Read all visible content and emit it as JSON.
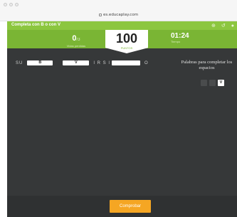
{
  "browser": {
    "url": "es.educaplay.com"
  },
  "header": {
    "title": "Completa con B o con V",
    "icons": [
      "globe-icon",
      "refresh-icon",
      "help-icon"
    ]
  },
  "score": {
    "lives_value": "0",
    "lives_total": "/3",
    "lives_label": "Vidas perdidas",
    "points_value": "100",
    "points_label": "PUNTOS",
    "timer_value": "01:24",
    "timer_label": "Tiempo"
  },
  "sentence": {
    "prefix": "SU",
    "blank1_value": "B",
    "blank2_value": "V",
    "middle": "I R S I",
    "blank3_value": "",
    "suffix": "O"
  },
  "panel": {
    "title": "Palabras para completar los espacios",
    "tile_letter": "V"
  },
  "footer": {
    "check_label": "Comprobar"
  },
  "colors": {
    "header_green": "#8cc63f",
    "score_green": "#7ab534",
    "game_bg": "#363839",
    "button_orange": "#f5a623"
  }
}
